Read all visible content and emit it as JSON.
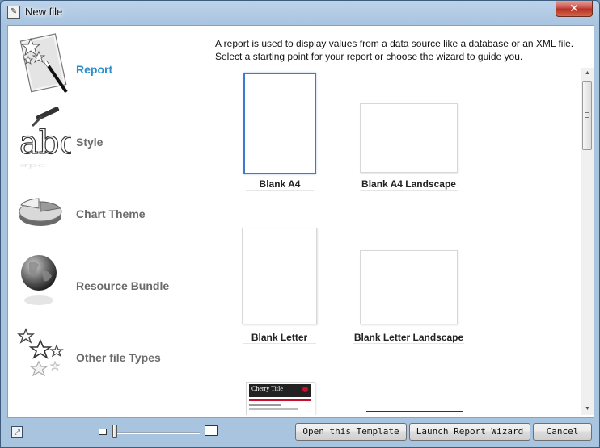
{
  "window": {
    "title": "New file",
    "close_label": "✕"
  },
  "sidebar": {
    "items": [
      {
        "label": "Report",
        "icon": "report-icon",
        "active": true
      },
      {
        "label": "Style",
        "icon": "style-icon",
        "active": false
      },
      {
        "label": "Chart Theme",
        "icon": "chart-theme-icon",
        "active": false
      },
      {
        "label": "Resource Bundle",
        "icon": "resource-bundle-icon",
        "active": false
      },
      {
        "label": "Other file Types",
        "icon": "other-file-types-icon",
        "active": false
      }
    ]
  },
  "description": {
    "line1": "A report is used to display values from a data source like a database or an XML file.",
    "line2": "Select a starting point for your report or choose the wizard to guide you."
  },
  "templates": [
    {
      "label": "Blank A4",
      "selected": true
    },
    {
      "label": "Blank A4 Landscape",
      "selected": false
    },
    {
      "label": "Blank Letter",
      "selected": false
    },
    {
      "label": "Blank Letter Landscape",
      "selected": false
    },
    {
      "label": "Cherry Title",
      "selected": false
    }
  ],
  "buttons": {
    "open_template": "Open this Template",
    "launch_wizard": "Launch Report Wizard",
    "cancel": "Cancel"
  },
  "colors": {
    "accent": "#2a8ecb",
    "selection": "#3d7bd1",
    "inactive_label": "#6a6a6a",
    "cherry_header": "#222222"
  }
}
